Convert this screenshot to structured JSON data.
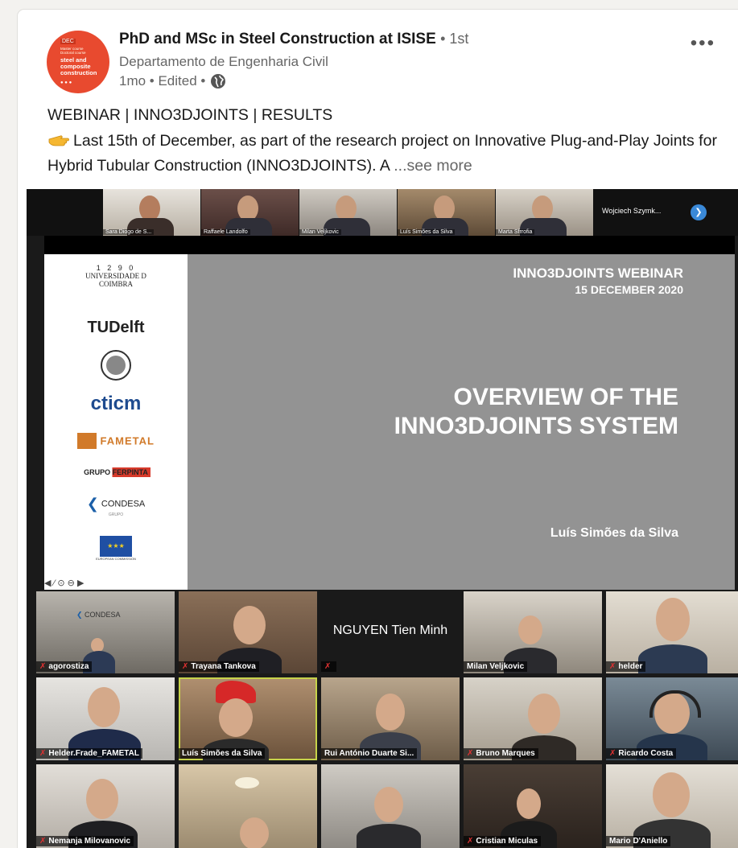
{
  "post": {
    "author_name": "PhD and MSc in Steel Construction at ISISE",
    "connection_degree": "• 1st",
    "subtitle": "Departamento de Engenharia Civil",
    "meta": "1mo • Edited •",
    "title_line": "WEBINAR | INNO3DJOINTS | RESULTS",
    "text": "Last 15th of December, as part of the research project on Innovative Plug-and-Play Joints for Hybrid Tubular Construction (INNO3DJOINTS). A",
    "see_more": "...see more",
    "more_menu": "•••"
  },
  "avatar": {
    "dec_label": "DEC",
    "small_text": "Master course\nDoctoral course",
    "big_text": "steel and\ncomposite\nconstruction",
    "dots": "● ● ●",
    "accent_color": "#e84a2f"
  },
  "top_strip": {
    "participants": [
      "Sara Diogo de S...",
      "Raffaele Landolfo",
      "Milan Veljkovic",
      "Luís Simões da Silva",
      "Marta Sfrrofia"
    ],
    "dark_label": "Wojciech Szymk...",
    "next_icon": "chevron-right-icon"
  },
  "slide": {
    "university_label": "UNIVERSIDADE D\nCOIMBRA",
    "university_year": "1 2 9 0",
    "logo_tudelft": "TUDelft",
    "logo_cticm": "cticm",
    "logo_fametal": "FAMETAL",
    "logo_ferpinta": "GRUPO FERPINTA",
    "logo_condesa": "CONDESA",
    "logo_condesa_sub": "GRUPO",
    "logo_ec": "EUROPEAN COMMISSION",
    "webinar_line": "INNO3DJOINTS WEBINAR",
    "date_line": "15 DECEMBER 2020",
    "title_line1": "OVERVIEW OF THE",
    "title_line2": "INNO3DJOINTS SYSTEM",
    "author": "Luís Simões da Silva",
    "controls": "◀ ⁄ ⊙ ⊖ ▶"
  },
  "gallery": [
    {
      "name": "agorostiza",
      "sign": "CONDESA"
    },
    {
      "name": "Trayana Tankova"
    },
    {
      "name": "",
      "center_name": "NGUYEN Tien Minh"
    },
    {
      "name": "Milan Veljkovic"
    },
    {
      "name": "helder"
    },
    {
      "name": "Helder.Frade_FAMETAL"
    },
    {
      "name": "Luís Simões da Silva"
    },
    {
      "name": "Rui António Duarte Si..."
    },
    {
      "name": "Bruno Marques"
    },
    {
      "name": "Ricardo Costa"
    },
    {
      "name": "Nemanja Milovanovic"
    },
    {
      "name": ""
    },
    {
      "name": ""
    },
    {
      "name": "Cristian Miculas"
    },
    {
      "name": "Mario D'Aniello"
    }
  ],
  "mic_glyph": "✗"
}
